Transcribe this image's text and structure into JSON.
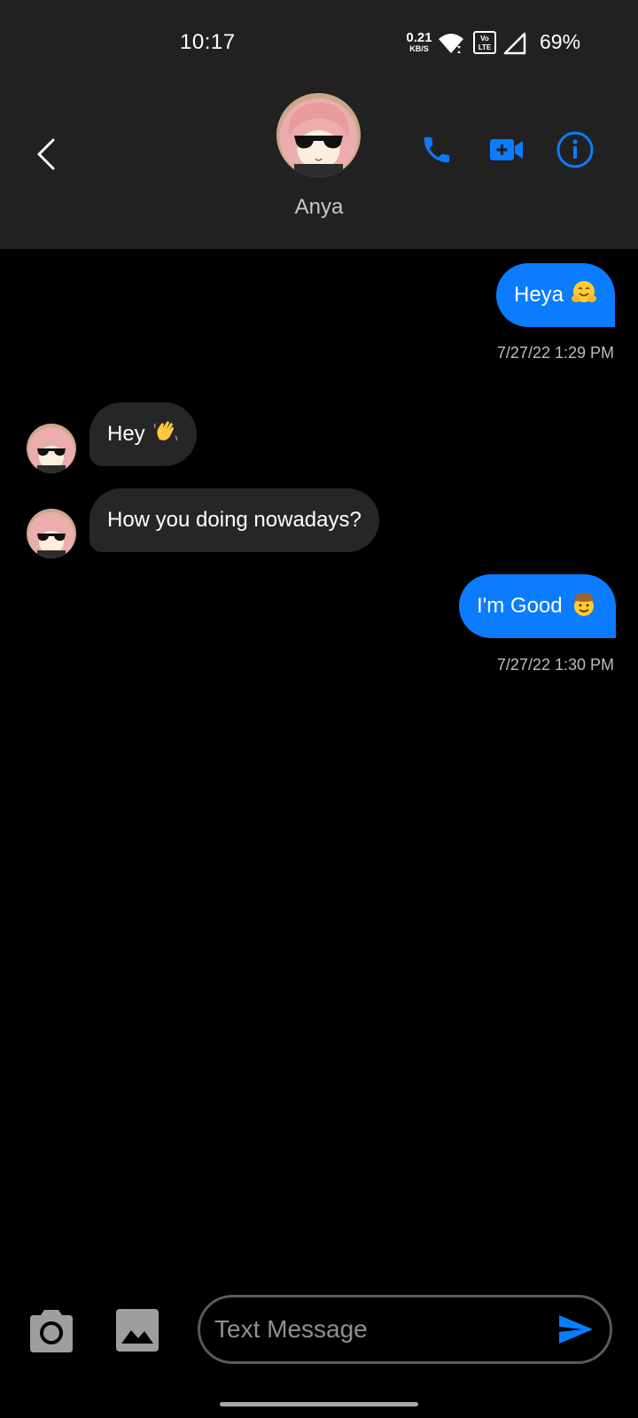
{
  "status_bar": {
    "time": "10:17",
    "net_speed_value": "0.21",
    "net_speed_unit": "KB/S",
    "battery": "69%",
    "icons": [
      "wifi-icon",
      "volte-icon",
      "signal-icon"
    ]
  },
  "header": {
    "contact_name": "Anya",
    "icons": [
      "back-chevron-icon",
      "phone-icon",
      "video-camera-icon",
      "info-icon"
    ],
    "accent_color": "#0b7cff"
  },
  "messages": [
    {
      "direction": "outgoing",
      "text": "Heya",
      "emoji": "hugging-face-emoji",
      "timestamp": "7/27/22 1:29 PM"
    },
    {
      "direction": "incoming",
      "text": "Hey",
      "emoji": "waving-hand-emoji"
    },
    {
      "direction": "incoming",
      "text": "How you doing nowadays?"
    },
    {
      "direction": "outgoing",
      "text": "I'm Good",
      "emoji": "cowboy-face-emoji",
      "timestamp": "7/27/22 1:30 PM"
    }
  ],
  "composer": {
    "placeholder": "Text Message",
    "value": "",
    "icons": [
      "camera-icon",
      "image-icon",
      "send-icon"
    ]
  },
  "colors": {
    "outgoing_bubble": "#0b7cff",
    "incoming_bubble": "#262626",
    "bar_background": "#212121",
    "background": "#000000"
  }
}
